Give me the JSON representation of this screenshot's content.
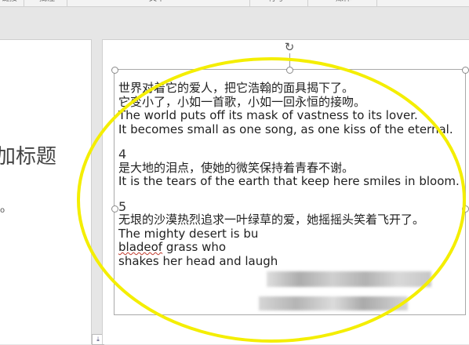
{
  "ribbon": {
    "labels": [
      "链接",
      "批注",
      "文本",
      "符号",
      "媒体"
    ]
  },
  "left_slide": {
    "title_fragment": "加标题",
    "mark": "o"
  },
  "text_box": {
    "lines": [
      "世界对着它的爱人，把它浩翰的面具揭下了。",
      "它变小了，小如一首歌，小如一回永恒的接吻。",
      "The world puts off its mask of vastness to its lover.",
      "It becomes small as one song, as one kiss of the eternal.",
      "4",
      "是大地的泪点，使她的微笑保持着青春不谢。",
      "It is the tears of the earth that keep here smiles in bloom.",
      "5",
      "无垠的沙漠热烈追求一叶绿草的爱，她摇摇头笑着飞开了。",
      "The mighty desert is bu",
      "bladeof",
      " grass who",
      "shakes her head and laugh"
    ]
  },
  "annotation": {
    "shape": "ellipse",
    "color": "#f4ee00"
  }
}
